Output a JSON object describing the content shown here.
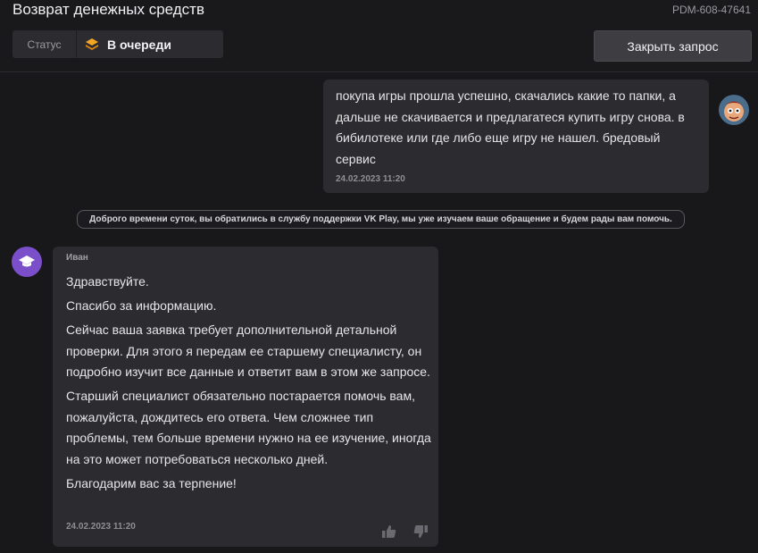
{
  "header": {
    "title": "Возврат денежных средств",
    "ticket_id": "PDM-608-47641",
    "status_label": "Статус",
    "status_value": "В очереди",
    "close_button": "Закрыть запрос"
  },
  "messages": {
    "user": {
      "text": "покупа игры прошла успешно, скачались какие то папки, а дальше не скачивается и предлагатеся купить игру снова. в бибилотеке или где либо еще игру не нашел. бредовый сервис",
      "time": "24.02.2023 11:20"
    },
    "system": {
      "text": "Доброго времени суток, вы обратились в службу поддержки VK Play, мы уже изучаем ваше обращение и будем рады вам помочь."
    },
    "agent": {
      "name": "Иван",
      "paragraphs": [
        "Здравствуйте.",
        "Спасибо за информацию.",
        "Сейчас ваша заявка требует дополнительной детальной проверки. Для этого я передам ее старшему специалисту, он подробно изучит все данные и ответит вам в этом же запросе.",
        "Старший специалист обязательно постарается помочь вам, пожалуйста, дождитесь его ответа. Чем сложнее тип проблемы, тем больше времени нужно на ее изучение, иногда на это может потребоваться несколько дней.",
        "Благодарим вас за терпение!"
      ],
      "time": "24.02.2023 11:20"
    }
  },
  "icons": {
    "status": "layers-icon",
    "agent_avatar": "graduation-cap-icon",
    "like": "thumbs-up-icon",
    "dislike": "thumbs-down-icon"
  },
  "colors": {
    "status_icon": "#f5a623",
    "agent_avatar_bg": "#7b4fc9"
  }
}
